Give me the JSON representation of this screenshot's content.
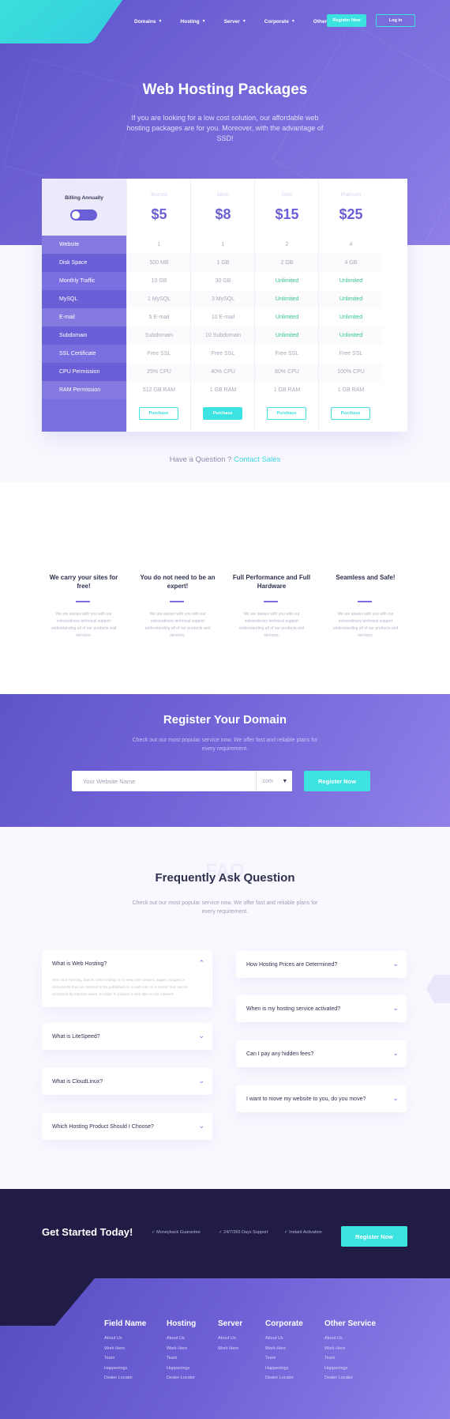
{
  "nav": {
    "items": [
      "Domains",
      "Hosting",
      "Server",
      "Corporate",
      "Other"
    ],
    "register": "Register Now",
    "login": "Log in"
  },
  "hero": {
    "title": "Web Hosting Packages",
    "subtitle": "If you are looking for a low cost solution, our affordable web hosting packages are for you. Moreover, with the advantage of SSD!"
  },
  "pricing": {
    "billing_label": "Billing Annually",
    "features": [
      "Website",
      "Disk Space",
      "Monthly Traffic",
      "MySQL",
      "E-mail",
      "Subdomain",
      "SSL Certificate",
      "CPU Permission",
      "RAM Permission"
    ],
    "plans": [
      {
        "name": "Bronze",
        "price": "$5",
        "button": "Purchase",
        "values": [
          "1",
          "500 MB",
          "10 GB",
          "1 MySQL",
          "5 E-mail",
          "Subdomain",
          "Free SSL",
          "25% CPU",
          "512 GB RAM"
        ]
      },
      {
        "name": "Silver",
        "price": "$8",
        "button": "Purchase",
        "values": [
          "1",
          "1 GB",
          "30 GB",
          "3 MySQL",
          "10 E-mail",
          "10 Subdomain",
          "Free SSL",
          "40% CPU",
          "1 GB RAM"
        ]
      },
      {
        "name": "Gold",
        "price": "$15",
        "button": "Purchase",
        "values": [
          "2",
          "2 GB",
          "Unlimited",
          "Unlimited",
          "Unlimited",
          "Unlimited",
          "Free SSL",
          "60% CPU",
          "1 GB RAM"
        ]
      },
      {
        "name": "Platinum",
        "price": "$25",
        "button": "Purchase",
        "values": [
          "4",
          "4 GB",
          "Unlimited",
          "Unlimited",
          "Unlimited",
          "Unlimited",
          "Free SSL",
          "100% CPU",
          "1 GB RAM"
        ]
      }
    ],
    "question": "Have a Question ?",
    "contact": "Contact Sales"
  },
  "features": [
    {
      "title": "We carry your sites for free!",
      "text": "We are always with you with our extraordinary technical support understanding all of our products and services."
    },
    {
      "title": "You do not need to be an expert!",
      "text": "We are always with you with our extraordinary technical support understanding all of our products and services."
    },
    {
      "title": "Full Performance and Full Hardware",
      "text": "We are always with you with our extraordinary technical support understanding all of our products and services."
    },
    {
      "title": "Seamless and Safe!",
      "text": "We are always with you with our extraordinary technical support understanding all of our products and services."
    }
  ],
  "domain": {
    "title": "Register Your Domain",
    "subtitle": "Check out our most popular service now. We offer fast and reliable plans for every requirement.",
    "placeholder": "Your Website  Name",
    "tld": ".com",
    "button": "Register Now"
  },
  "faq": {
    "ghost": "FAQ",
    "title": "Frequently Ask Question",
    "subtitle": "Check out our most popular service now. We offer fast and reliable plans for every requirement.",
    "left": [
      {
        "q": "What is Web Hosting?",
        "a": "Web Site Hosting, that is, web hosting, is to keep the content, pages, images or documents that are desired to be published on a web site on a server that can be accessed by internet users. In order to publish a web site on the internet."
      },
      {
        "q": "What is LiteSpeed?"
      },
      {
        "q": "What is CloudLinux?"
      },
      {
        "q": "Which Hosting Product Should I Choose?"
      }
    ],
    "right": [
      {
        "q": "How Hosting Prices are Determined?"
      },
      {
        "q": "When is my hosting service activated?"
      },
      {
        "q": "Can I pay any hidden fees?"
      },
      {
        "q": "I want to move my website to you, do you move?"
      }
    ]
  },
  "cta": {
    "title": "Get Started Today!",
    "checks": [
      "Moneyback Guarantee",
      "24/7/365 Days Support",
      "Instant Activation"
    ],
    "button": "Register Now"
  },
  "footer": {
    "columns": [
      {
        "title": "Field Name",
        "links": [
          "About Us",
          "Work Here",
          "Team",
          "Happenings",
          "Dealer Locator"
        ]
      },
      {
        "title": "Hosting",
        "links": [
          "About Us",
          "Work Here",
          "Team",
          "Happenings",
          "Dealer Locator"
        ]
      },
      {
        "title": "Server",
        "links": [
          "About Us",
          "Work Here"
        ]
      },
      {
        "title": "Corporate",
        "links": [
          "About Us",
          "Work Here",
          "Team",
          "Happenings",
          "Dealer Locator"
        ]
      },
      {
        "title": "Other Service",
        "links": [
          "About Us",
          "Work Here",
          "Team",
          "Happenings",
          "Dealer Locator"
        ]
      }
    ]
  },
  "colors": {
    "accent": "#3de3e0",
    "primary": "#6a5fd6",
    "dark": "#201c45",
    "green": "#33c48a"
  }
}
